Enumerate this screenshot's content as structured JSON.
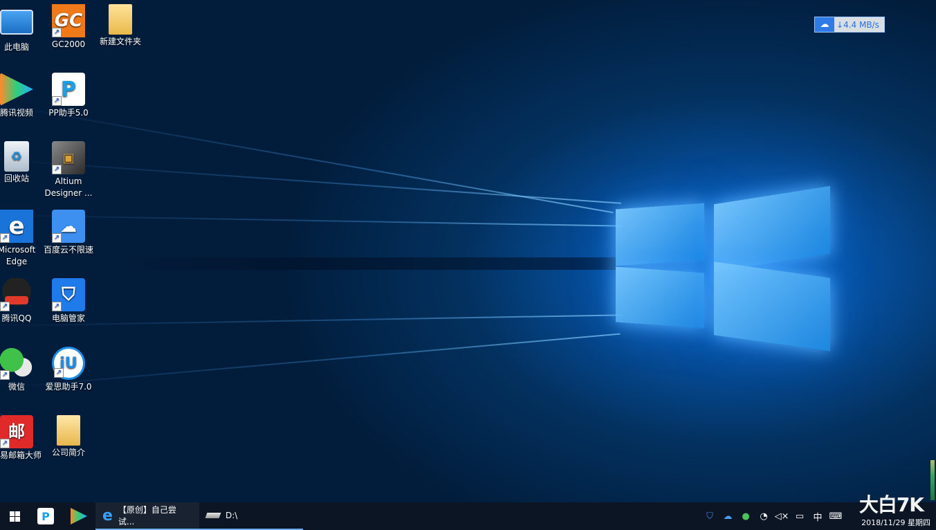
{
  "desktop_icons": [
    {
      "label": "此电脑",
      "icon": "computer-icon"
    },
    {
      "label": "GC2000",
      "icon": "gc2000-icon"
    },
    {
      "label": "新建文件夹",
      "icon": "folder-icon"
    },
    {
      "label": "腾讯视频",
      "icon": "tencent-video-icon"
    },
    {
      "label": "PP助手5.0",
      "icon": "pp-assistant-icon"
    },
    {
      "label": "回收站",
      "icon": "recycle-bin-icon"
    },
    {
      "label": "Altium Designer ...",
      "icon": "altium-icon"
    },
    {
      "label": "Microsoft Edge",
      "icon": "edge-icon"
    },
    {
      "label": "百度云不限速",
      "icon": "baidu-cloud-icon"
    },
    {
      "label": "腾讯QQ",
      "icon": "qq-icon"
    },
    {
      "label": "电脑管家",
      "icon": "pc-manager-icon"
    },
    {
      "label": "微信",
      "icon": "wechat-icon"
    },
    {
      "label": "爱思助手7.0",
      "icon": "i4-assistant-icon"
    },
    {
      "label": "网易邮箱大师",
      "icon": "netease-mail-icon"
    },
    {
      "label": "公司简介",
      "icon": "company-folder-icon"
    }
  ],
  "speed_widget": {
    "value": "4.4 MB/s",
    "arrow": "↓"
  },
  "taskbar": {
    "start": "start-icon",
    "pinned": [
      "pp-assistant-icon",
      "tencent-video-icon"
    ],
    "apps": [
      {
        "label": "【原创】自己尝试...",
        "icon": "edge-icon"
      },
      {
        "label": "D:\\",
        "icon": "drive-icon"
      }
    ],
    "tray": {
      "ime": "中",
      "date": "2018/11/29 星期四",
      "watermark": "大白7K"
    }
  },
  "colors": {
    "accent": "#6ab0ff",
    "taskbar": "#0b1524"
  }
}
